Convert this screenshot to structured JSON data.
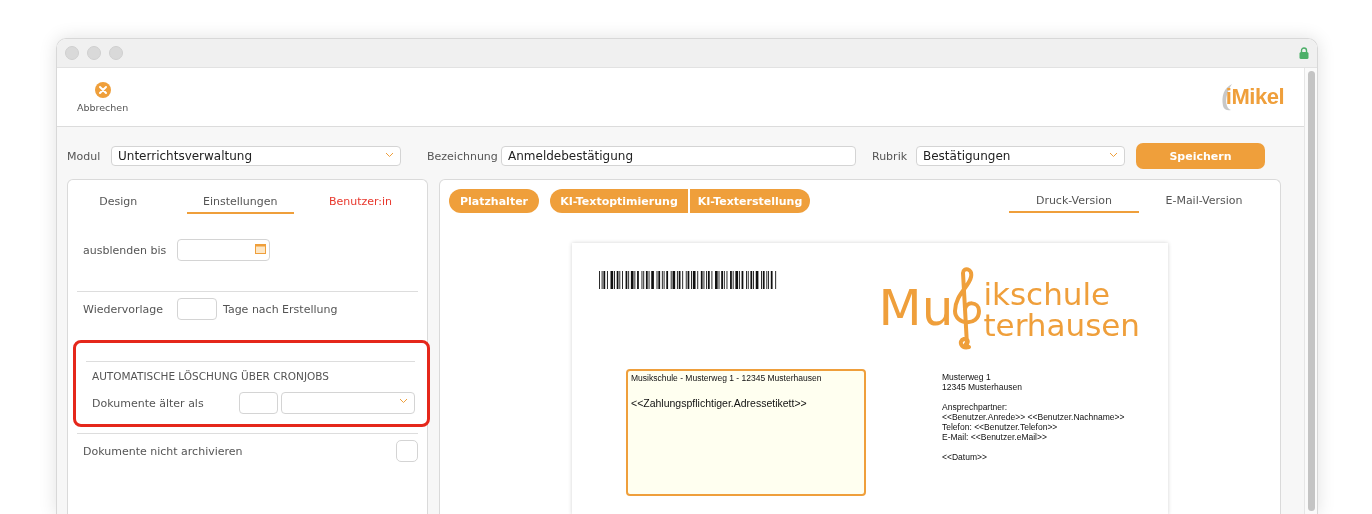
{
  "toolbar": {
    "cancel_label": "Abbrechen",
    "logo": "iMikel"
  },
  "form": {
    "modul": {
      "label": "Modul",
      "value": "Unterrichtsverwaltung"
    },
    "bezeichnung": {
      "label": "Bezeichnung",
      "value": "Anmeldebestätigung"
    },
    "rubrik": {
      "label": "Rubrik",
      "value": "Bestätigungen"
    },
    "save_button": "Speichern"
  },
  "left_panel": {
    "tabs": [
      {
        "label": "Design",
        "selected": false,
        "warning": false
      },
      {
        "label": "Einstellungen",
        "selected": true,
        "warning": false
      },
      {
        "label": "Benutzer:in",
        "selected": false,
        "warning": true
      }
    ],
    "hide_until": {
      "label": "ausblenden bis"
    },
    "resubmission": {
      "label": "Wiedervorlage",
      "suffix": "Tage nach Erstellung"
    },
    "auto_delete": {
      "highlighted": true,
      "heading": "AUTOMATISCHE LÖSCHUNG ÜBER CRONJOBS",
      "label": "Dokumente älter als"
    },
    "no_archive": {
      "label": "Dokumente nicht archivieren",
      "checked": false
    }
  },
  "right_panel": {
    "buttons": [
      "Platzhalter",
      "KI-Textoptimierung",
      "KI-Texterstellung"
    ],
    "tabs": [
      {
        "label": "Druck-Version",
        "selected": true
      },
      {
        "label": "E-Mail-Version",
        "selected": false
      }
    ],
    "document": {
      "logo": [
        "Mu",
        "ikschule",
        "terhausen"
      ],
      "sender_line": "Musikschule - Musterweg 1 - 12345 Musterhausen",
      "address_placeholder": "<<Zahlungspflichtiger.Adressetikett>>",
      "info_blocks": [
        [
          "Musterweg 1",
          "12345 Musterhausen"
        ],
        [
          "Ansprechpartner:",
          "<<Benutzer.Anrede>> <<Benutzer.Nachname>>",
          "Telefon: <<Benutzer.Telefon>>",
          "E-Mail: <<Benutzer.eMail>>"
        ],
        [
          "<<Datum>>"
        ]
      ]
    }
  }
}
